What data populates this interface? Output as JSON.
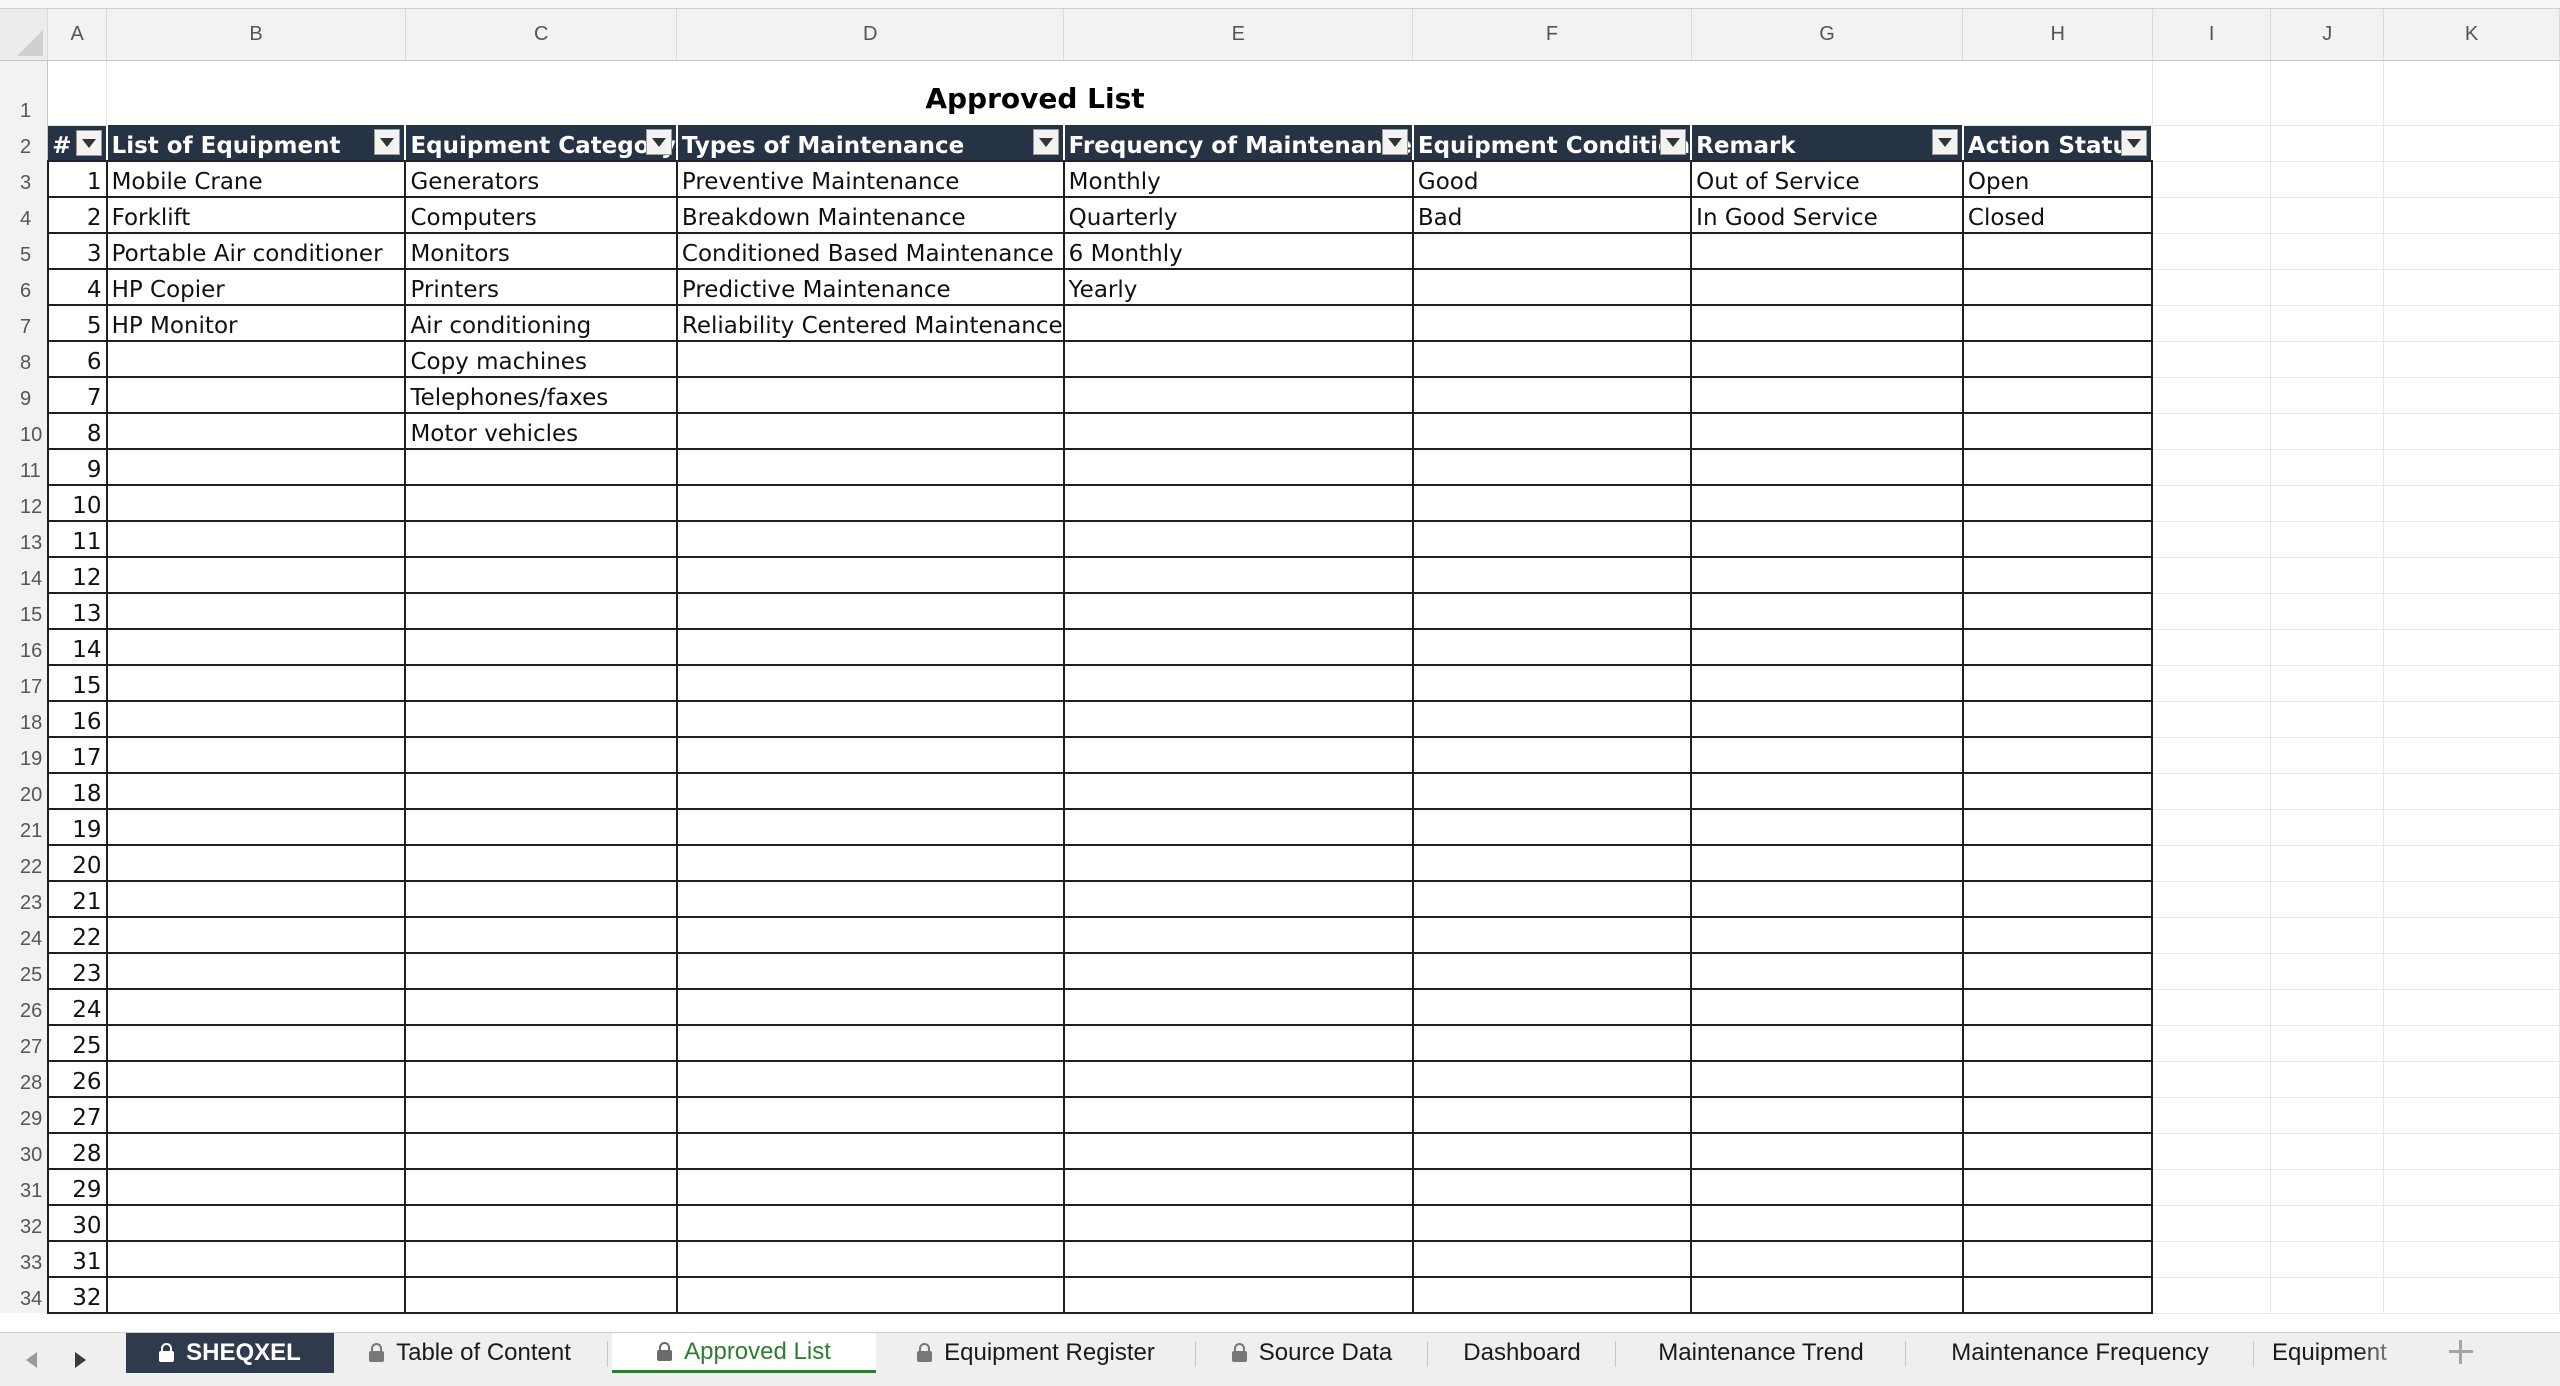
{
  "sheet": {
    "title": "Approved List",
    "column_letters": [
      "A",
      "B",
      "C",
      "D",
      "E",
      "F",
      "G",
      "H",
      "I",
      "J",
      "K"
    ],
    "headers": [
      "#",
      "List of Equipment",
      "Equipment Category",
      "Types of Maintenance",
      "Frequency of Maintenance",
      "Equipment Condition",
      "Remark",
      "Action Status"
    ],
    "rows": [
      [
        "1",
        "Mobile Crane",
        "Generators",
        "Preventive Maintenance",
        "Monthly",
        "Good",
        "Out of Service",
        "Open"
      ],
      [
        "2",
        "Forklift",
        "Computers",
        "Breakdown Maintenance",
        "Quarterly",
        "Bad",
        "In Good Service",
        "Closed"
      ],
      [
        "3",
        "Portable Air conditioner",
        "Monitors",
        "Conditioned Based Maintenance",
        "6 Monthly",
        "",
        "",
        ""
      ],
      [
        "4",
        "HP Copier",
        "Printers",
        "Predictive Maintenance",
        "Yearly",
        "",
        "",
        ""
      ],
      [
        "5",
        "HP Monitor",
        "Air conditioning",
        "Reliability Centered Maintenance",
        "",
        "",
        "",
        ""
      ],
      [
        "6",
        "",
        "Copy machines",
        "",
        "",
        "",
        "",
        ""
      ],
      [
        "7",
        "",
        "Telephones/faxes",
        "",
        "",
        "",
        "",
        ""
      ],
      [
        "8",
        "",
        "Motor vehicles",
        "",
        "",
        "",
        "",
        ""
      ],
      [
        "9",
        "",
        "",
        "",
        "",
        "",
        "",
        ""
      ],
      [
        "10",
        "",
        "",
        "",
        "",
        "",
        "",
        ""
      ],
      [
        "11",
        "",
        "",
        "",
        "",
        "",
        "",
        ""
      ],
      [
        "12",
        "",
        "",
        "",
        "",
        "",
        "",
        ""
      ],
      [
        "13",
        "",
        "",
        "",
        "",
        "",
        "",
        ""
      ],
      [
        "14",
        "",
        "",
        "",
        "",
        "",
        "",
        ""
      ],
      [
        "15",
        "",
        "",
        "",
        "",
        "",
        "",
        ""
      ],
      [
        "16",
        "",
        "",
        "",
        "",
        "",
        "",
        ""
      ],
      [
        "17",
        "",
        "",
        "",
        "",
        "",
        "",
        ""
      ],
      [
        "18",
        "",
        "",
        "",
        "",
        "",
        "",
        ""
      ],
      [
        "19",
        "",
        "",
        "",
        "",
        "",
        "",
        ""
      ],
      [
        "20",
        "",
        "",
        "",
        "",
        "",
        "",
        ""
      ],
      [
        "21",
        "",
        "",
        "",
        "",
        "",
        "",
        ""
      ],
      [
        "22",
        "",
        "",
        "",
        "",
        "",
        "",
        ""
      ],
      [
        "23",
        "",
        "",
        "",
        "",
        "",
        "",
        ""
      ],
      [
        "24",
        "",
        "",
        "",
        "",
        "",
        "",
        ""
      ],
      [
        "25",
        "",
        "",
        "",
        "",
        "",
        "",
        ""
      ],
      [
        "26",
        "",
        "",
        "",
        "",
        "",
        "",
        ""
      ],
      [
        "27",
        "",
        "",
        "",
        "",
        "",
        "",
        ""
      ],
      [
        "28",
        "",
        "",
        "",
        "",
        "",
        "",
        ""
      ],
      [
        "29",
        "",
        "",
        "",
        "",
        "",
        "",
        ""
      ],
      [
        "30",
        "",
        "",
        "",
        "",
        "",
        "",
        ""
      ],
      [
        "31",
        "",
        "",
        "",
        "",
        "",
        "",
        ""
      ],
      [
        "32",
        "",
        "",
        "",
        "",
        "",
        "",
        ""
      ]
    ]
  },
  "tabs": [
    {
      "label": "SHEQXEL",
      "locked": true,
      "style": "dark"
    },
    {
      "label": "Table of Content",
      "locked": true,
      "style": "light"
    },
    {
      "label": "Approved List",
      "locked": true,
      "style": "active"
    },
    {
      "label": "Equipment Register",
      "locked": true,
      "style": "light"
    },
    {
      "label": "Source Data",
      "locked": true,
      "style": "light"
    },
    {
      "label": "Dashboard",
      "locked": false,
      "style": "light"
    },
    {
      "label": "Maintenance Trend",
      "locked": false,
      "style": "light"
    },
    {
      "label": "Maintenance Frequency",
      "locked": false,
      "style": "light"
    },
    {
      "label": "Equipment",
      "locked": false,
      "style": "light"
    }
  ],
  "colors": {
    "header_bg": "#263344",
    "header_text": "#ffffff",
    "active_tab_text": "#2e7d32",
    "dark_tab_bg": "#2f3b4c"
  },
  "icons": {
    "filter": "dropdown-arrow-icon",
    "lock": "lock-icon",
    "scroll_left": "scroll-left-icon",
    "scroll_right": "scroll-right-icon",
    "add_sheet": "plus-icon"
  }
}
